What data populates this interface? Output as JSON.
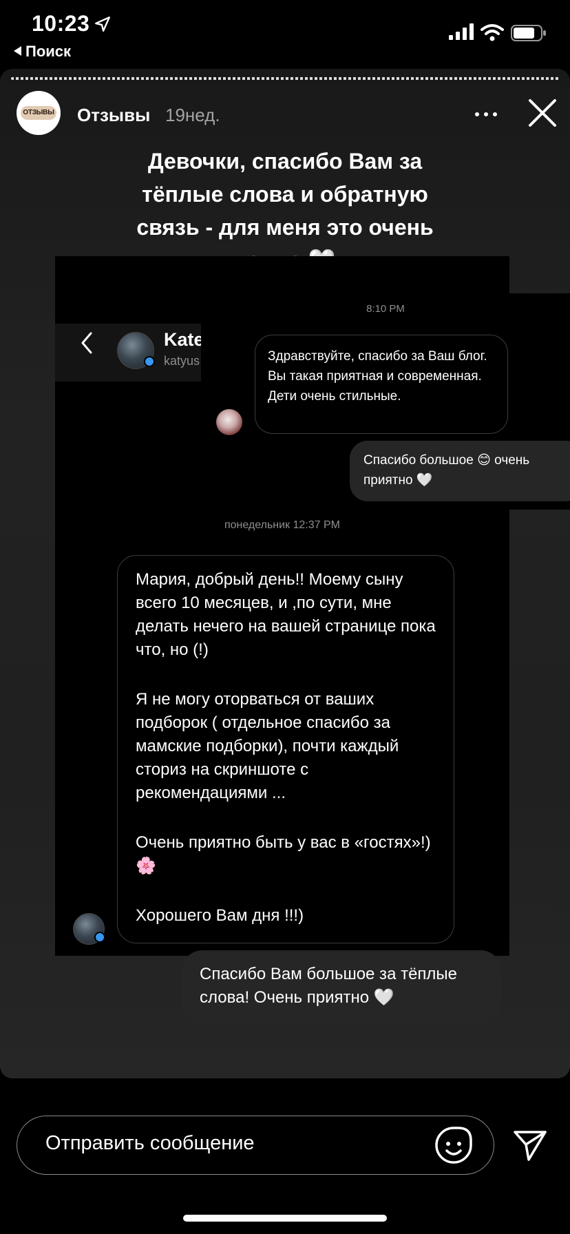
{
  "status_bar": {
    "time": "10:23",
    "back_label": "Поиск"
  },
  "story": {
    "account_name": "Отзывы",
    "avatar_text": "ОТЗЫВЫ",
    "time_ago": "19нед.",
    "caption_line1": "Девочки, спасибо Вам за",
    "caption_line2": "тёплые слова и обратную",
    "caption_line3": "связь - для меня это очень",
    "caption_line4": "важно 🤍"
  },
  "screenshot": {
    "chat_name": "Kate",
    "chat_username": "katyus",
    "timestamp_1": "8:10 PM",
    "msg_1": "Здравствуйте, спасибо за Ваш блог. Вы такая приятная и современная. Дети очень стильные.",
    "msg_2": "Спасибо большое 😊 очень приятно 🤍",
    "timestamp_2": "понедельник 12:37 PM",
    "msg_3": {
      "p1": "Мария, добрый день!! Моему сыну всего 10 месяцев, и ,по сути, мне делать нечего на вашей странице пока что, но (!)",
      "p2": "Я не могу оторваться от ваших подборок ( отдельное спасибо за мамские подборки), почти каждый сториз на скриншоте с рекомендациями ...",
      "p3": "Очень приятно быть у вас в «гостях»!) 🌸",
      "p4": "Хорошего Вам дня !!!)"
    },
    "msg_4": "Спасибо Вам большое за тёплые слова! Очень приятно 🤍"
  },
  "reply_bar": {
    "placeholder": "Отправить сообщение"
  },
  "icons": {
    "location": "location-arrow-icon",
    "signal": "cellular-signal-icon",
    "wifi": "wifi-icon",
    "battery": "battery-icon",
    "more": "more-dots-icon",
    "close": "close-icon",
    "back": "chevron-left-icon",
    "sticker": "sticker-face-icon",
    "send": "send-icon"
  }
}
